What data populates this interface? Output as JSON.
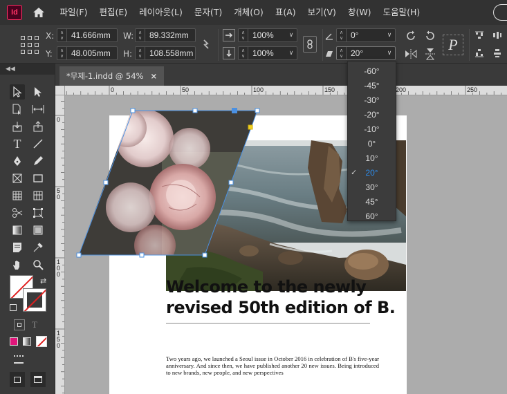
{
  "app": {
    "logo_text": "Id"
  },
  "menu": [
    "파일(F)",
    "편집(E)",
    "레이아웃(L)",
    "문자(T)",
    "개체(O)",
    "표(A)",
    "보기(V)",
    "창(W)",
    "도움말(H)"
  ],
  "control": {
    "x_label": "X:",
    "x_value": "41.666mm",
    "y_label": "Y:",
    "y_value": "48.005mm",
    "w_label": "W:",
    "w_value": "89.332mm",
    "h_label": "H:",
    "h_value": "108.558mm",
    "scale_x": "100%",
    "scale_y": "100%",
    "rotate_value": "0°",
    "shear_value": "20°"
  },
  "shear_options": [
    "-60°",
    "-45°",
    "-30°",
    "-20°",
    "-10°",
    "0°",
    "10°",
    "20°",
    "30°",
    "45°",
    "60°"
  ],
  "shear_selected": "20°",
  "document": {
    "tab_title": "*무제-1.indd @ 54%",
    "tab_close": "×",
    "headline": "Welcome to the newly revised 50th edition of B.",
    "body": "Two years ago, we launched a Seoul issue in October 2016 in celebration of B's five-year anniversary. And since then, we have published another 20 new issues. Being introduced to new brands, new people, and new perspectives"
  },
  "ruler": {
    "top_labels": [
      "0",
      "50",
      "100",
      "150",
      "200",
      "250"
    ],
    "left_labels": [
      "0",
      "5",
      "0",
      "1",
      "0",
      "0",
      "1",
      "5",
      "0"
    ]
  },
  "colors": {
    "selection": "#4a90e2",
    "accent_pink": "#e0157a",
    "selected_option": "#2d8ceb"
  }
}
